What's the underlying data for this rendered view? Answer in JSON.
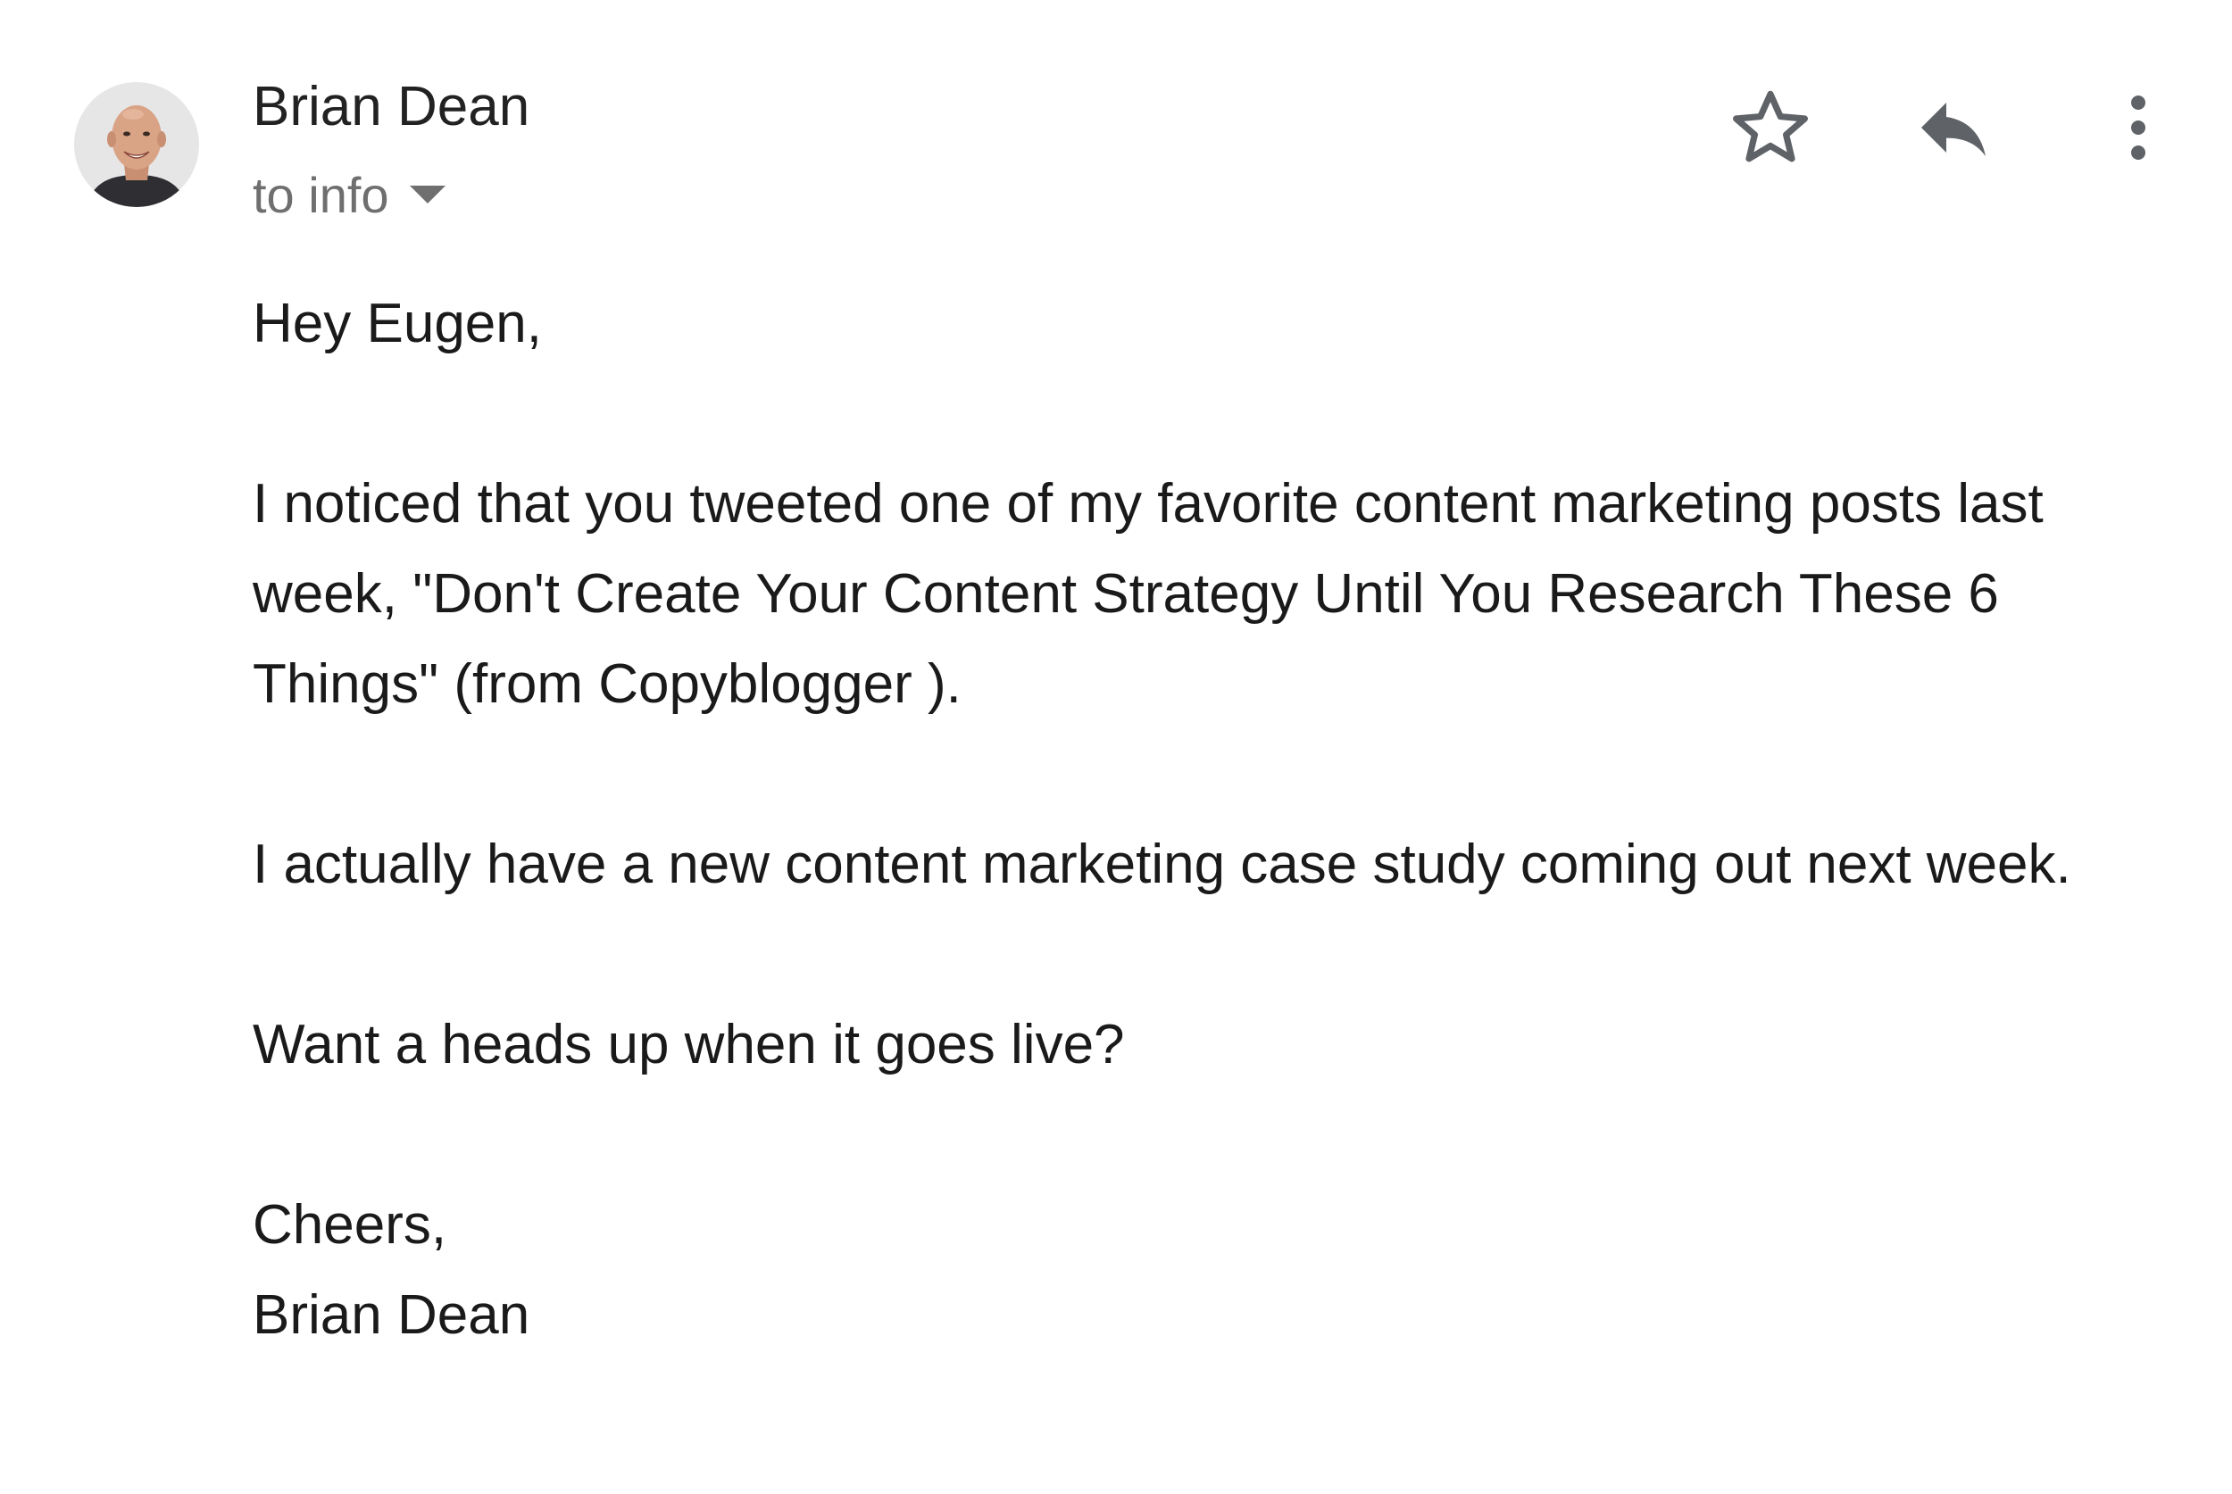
{
  "sender": {
    "name": "Brian Dean",
    "recipient_text": "to info",
    "avatar_icon": "avatar-photo"
  },
  "actions": {
    "star_icon": "star-outline-icon",
    "reply_icon": "reply-icon",
    "more_icon": "more-vert-icon"
  },
  "message": {
    "greeting": "Hey Eugen,",
    "paragraph_1": "I noticed that you tweeted one of my favorite content marketing posts last week, \"Don't Create Your Content Strategy Until You Research These 6 Things\" (from Copyblogger ).",
    "paragraph_2": "I actually have a new content marketing case study coming out next week.",
    "paragraph_3": "Want a heads up when it goes live?",
    "signoff": "Cheers,",
    "signature": "Brian Dean"
  },
  "colors": {
    "text": "#222222",
    "muted": "#6f6f6f",
    "icon": "#5f6368"
  }
}
